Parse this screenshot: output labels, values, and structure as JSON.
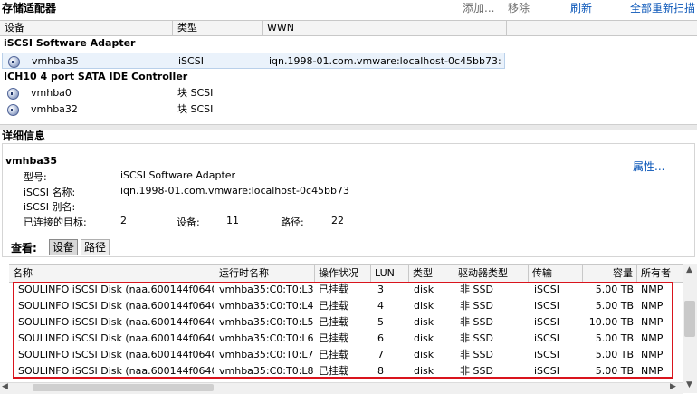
{
  "header": {
    "title": "存储适配器",
    "add": "添加...",
    "remove": "移除",
    "refresh": "刷新",
    "rescan_all": "全部重新扫描"
  },
  "adapters": {
    "columns": [
      "设备",
      "类型",
      "WWN"
    ],
    "groups": [
      {
        "name": "iSCSI Software Adapter",
        "rows": [
          {
            "device": "vmhba35",
            "type": "iSCSI",
            "wwn": "iqn.1998-01.com.vmware:localhost-0c45bb73:",
            "selected": true
          }
        ]
      },
      {
        "name": "ICH10 4 port SATA IDE Controller",
        "rows": [
          {
            "device": "vmhba0",
            "type": "块 SCSI",
            "wwn": ""
          },
          {
            "device": "vmhba32",
            "type": "块 SCSI",
            "wwn": ""
          }
        ]
      }
    ]
  },
  "details": {
    "section_title": "详细信息",
    "adapter_name": "vmhba35",
    "properties_link": "属性...",
    "model_label": "型号:",
    "model_value": "iSCSI Software Adapter",
    "iscsi_name_label": "iSCSI 名称:",
    "iscsi_name_value": "iqn.1998-01.com.vmware:localhost-0c45bb73",
    "iscsi_alias_label": "iSCSI 别名:",
    "iscsi_alias_value": "",
    "targets_label": "已连接的目标:",
    "targets_value": "2",
    "devices_label": "设备:",
    "devices_value": "11",
    "paths_label": "路径:",
    "paths_value": "22"
  },
  "view": {
    "label": "查看:",
    "devices_button": "设备",
    "paths_button": "路径",
    "active": "设备"
  },
  "devices": {
    "columns": [
      "名称",
      "运行时名称",
      "操作状况",
      "LUN",
      "类型",
      "驱动器类型",
      "传输",
      "容量",
      "所有者"
    ],
    "rows": [
      {
        "name": "SOULINFO iSCSI Disk (naa.600144f0640...",
        "runtime": "vmhba35:C0:T0:L3",
        "status": "已挂载",
        "lun": "3",
        "type": "disk",
        "drive": "非 SSD",
        "transport": "iSCSI",
        "capacity": "5.00 TB",
        "owner": "NMP"
      },
      {
        "name": "SOULINFO iSCSI Disk (naa.600144f0640...",
        "runtime": "vmhba35:C0:T0:L4",
        "status": "已挂载",
        "lun": "4",
        "type": "disk",
        "drive": "非 SSD",
        "transport": "iSCSI",
        "capacity": "5.00 TB",
        "owner": "NMP"
      },
      {
        "name": "SOULINFO iSCSI Disk (naa.600144f0640...",
        "runtime": "vmhba35:C0:T0:L5",
        "status": "已挂载",
        "lun": "5",
        "type": "disk",
        "drive": "非 SSD",
        "transport": "iSCSI",
        "capacity": "10.00 TB",
        "owner": "NMP"
      },
      {
        "name": "SOULINFO iSCSI Disk (naa.600144f0640...",
        "runtime": "vmhba35:C0:T0:L6",
        "status": "已挂载",
        "lun": "6",
        "type": "disk",
        "drive": "非 SSD",
        "transport": "iSCSI",
        "capacity": "5.00 TB",
        "owner": "NMP"
      },
      {
        "name": "SOULINFO iSCSI Disk (naa.600144f0640...",
        "runtime": "vmhba35:C0:T0:L7",
        "status": "已挂载",
        "lun": "7",
        "type": "disk",
        "drive": "非 SSD",
        "transport": "iSCSI",
        "capacity": "5.00 TB",
        "owner": "NMP"
      },
      {
        "name": "SOULINFO iSCSI Disk (naa.600144f0640...",
        "runtime": "vmhba35:C0:T0:L8",
        "status": "已挂载",
        "lun": "8",
        "type": "disk",
        "drive": "非 SSD",
        "transport": "iSCSI",
        "capacity": "5.00 TB",
        "owner": "NMP"
      }
    ]
  },
  "colors": {
    "link": "#0a56b8",
    "highlight_border": "#d9141d",
    "selection": "#eaf2fb"
  }
}
